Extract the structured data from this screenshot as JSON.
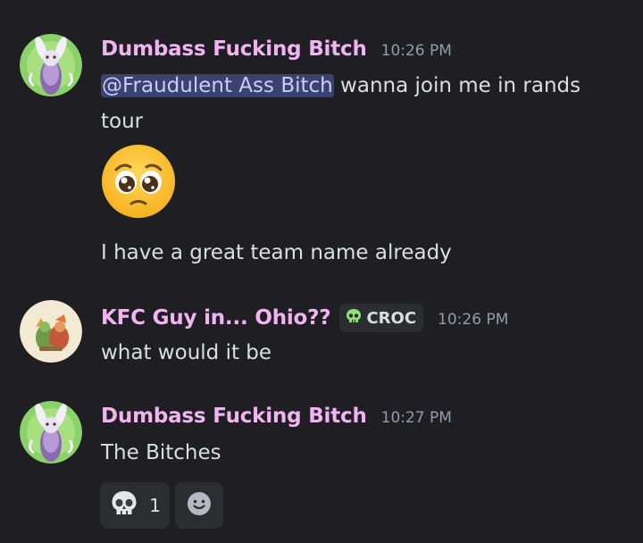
{
  "messages": [
    {
      "username": "Dumbass Fucking Bitch",
      "timestamp": "10:26 PM",
      "mention": "@Fraudulent Ass Bitch",
      "line1_rest": " wanna join me in rands",
      "line2": "tour",
      "emoji": "pleading-face-emoji",
      "line3": "I have a great team name already"
    },
    {
      "username": "KFC Guy in... Ohio??",
      "tag": "CROC",
      "tag_icon": "skull-icon",
      "timestamp": "10:26 PM",
      "text": "what would it be"
    },
    {
      "username": "Dumbass Fucking Bitch",
      "timestamp": "10:27 PM",
      "text": "The Bitches",
      "reactions": [
        {
          "icon": "skull-icon",
          "count": "1"
        },
        {
          "icon": "add-reaction-icon"
        }
      ]
    }
  ],
  "colors": {
    "background": "#1f1f23",
    "username": "#f0b4f0",
    "mention_bg": "#3c4270",
    "mention_text": "#c9cdfb",
    "timestamp": "#949ba4",
    "text": "#dbdee1",
    "chip_bg": "#2b2d31",
    "tag_skull": "#8fe07a"
  }
}
